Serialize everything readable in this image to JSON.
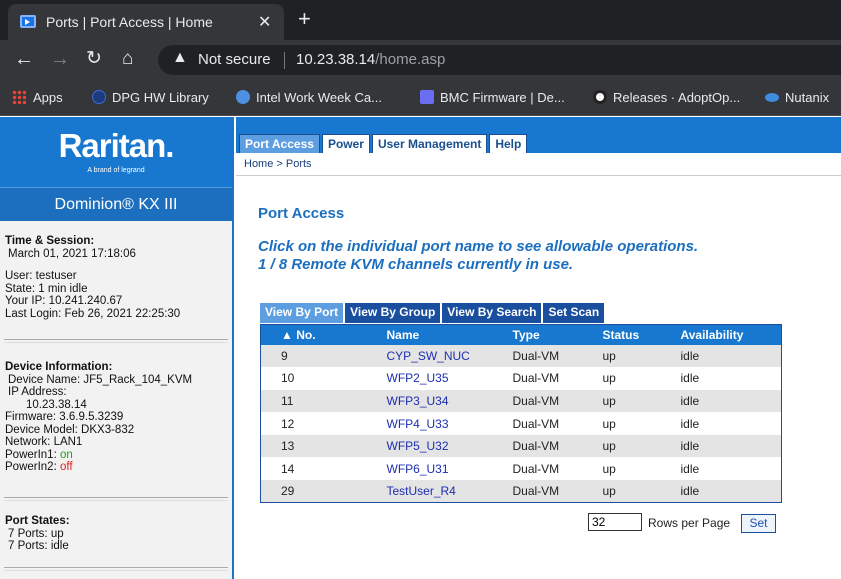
{
  "browser": {
    "tab_title": "Ports | Port Access | Home",
    "tab_close": "✕",
    "new_tab": "+",
    "security_label": "Not secure",
    "url_host": "10.23.38.14",
    "url_path": "/home.asp",
    "bookmarks": [
      {
        "label": "Apps"
      },
      {
        "label": "DPG HW Library"
      },
      {
        "label": "Intel Work Week Ca..."
      },
      {
        "label": "BMC Firmware | De..."
      },
      {
        "label": "Releases · AdoptOp..."
      },
      {
        "label": "Nutanix"
      }
    ]
  },
  "sidebar": {
    "logo": "Raritan.",
    "logo_sub": "A brand of  legrand",
    "product": "Dominion® KX III",
    "time_session": {
      "header": "Time & Session:",
      "datetime": "March 01, 2021 17:18:06",
      "user": "User: testuser",
      "state": "State: 1 min idle",
      "ip": "Your IP: 10.241.240.67",
      "last_login": "Last Login: Feb 26, 2021 22:25:30"
    },
    "device": {
      "header": "Device Information:",
      "name": "Device Name: JF5_Rack_104_KVM",
      "ip_label": "IP Address:",
      "ip_value": "10.23.38.14",
      "firmware": "Firmware: 3.6.9.5.3239",
      "model": "Device Model: DKX3-832",
      "network": "Network: LAN1",
      "powerin1_label": "PowerIn1: ",
      "powerin1_value": "on",
      "powerin2_label": "PowerIn2: ",
      "powerin2_value": "off"
    },
    "port_states": {
      "header": "Port States:",
      "up": "7 Ports: up",
      "idle": "7 Ports: idle"
    }
  },
  "topnav": {
    "tabs": [
      {
        "label": "Port Access"
      },
      {
        "label": "Power"
      },
      {
        "label": "User Management"
      },
      {
        "label": "Help"
      }
    ],
    "breadcrumb": "Home > Ports"
  },
  "main": {
    "title": "Port Access",
    "instruction_line1": "Click on the individual port name to see allowable operations.",
    "instruction_line2": "1 / 8 Remote KVM channels currently in use.",
    "view_tabs": [
      {
        "label": "View By Port"
      },
      {
        "label": "View By Group"
      },
      {
        "label": "View By Search"
      },
      {
        "label": "Set Scan"
      }
    ],
    "table": {
      "headers": [
        "▲ No.",
        "Name",
        "Type",
        "Status",
        "Availability"
      ],
      "rows": [
        [
          "9",
          "CYP_SW_NUC",
          "Dual-VM",
          "up",
          "idle"
        ],
        [
          "10",
          "WFP2_U35",
          "Dual-VM",
          "up",
          "idle"
        ],
        [
          "11",
          "WFP3_U34",
          "Dual-VM",
          "up",
          "idle"
        ],
        [
          "12",
          "WFP4_U33",
          "Dual-VM",
          "up",
          "idle"
        ],
        [
          "13",
          "WFP5_U32",
          "Dual-VM",
          "up",
          "idle"
        ],
        [
          "14",
          "WFP6_U31",
          "Dual-VM",
          "up",
          "idle"
        ],
        [
          "29",
          "TestUser_R4",
          "Dual-VM",
          "up",
          "idle"
        ]
      ]
    },
    "rows_per_page_value": "32",
    "rows_per_page_label": "Rows per Page",
    "set_label": "Set"
  },
  "colors": {
    "brand_blue": "#1878cf",
    "link_blue": "#1c2fb0",
    "on_green": "#1aa31a",
    "off_red": "#e0201f"
  }
}
